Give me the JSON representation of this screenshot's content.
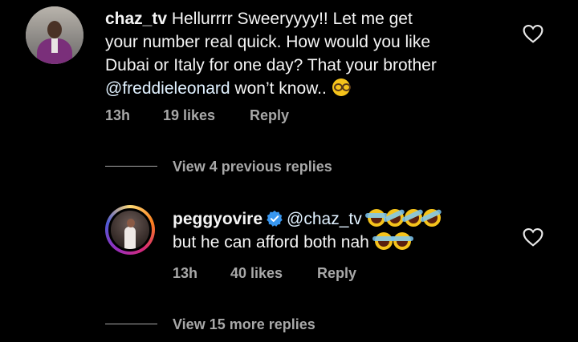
{
  "comments": [
    {
      "username": "chaz_tv",
      "text_line1": " Hellurrrr Sweeryyyy!! Let me get",
      "text_line2": "your number real quick. How would you like",
      "text_line3": "Dubai or Italy for one day? That your brother",
      "mention": "@freddieleonard",
      "text_line4_rest": " won’t know..",
      "emoji": "nerd-face",
      "time": "13h",
      "likes": "19 likes",
      "reply_label": "Reply"
    },
    {
      "username": "peggyovire",
      "verified": true,
      "mention": "@chaz_tv",
      "emojis_line1": [
        "laughing",
        "rolling-on-floor-laughing",
        "rolling-on-floor-laughing",
        "rolling-on-floor-laughing"
      ],
      "text_line2": "but he can afford both nah",
      "emojis_line2": [
        "laughing",
        "laughing"
      ],
      "time": "13h",
      "likes": "40 likes",
      "reply_label": "Reply"
    }
  ],
  "view_previous": "View 4 previous replies",
  "view_more": "View 15 more replies",
  "colors": {
    "background": "#000000",
    "text": "#f5f5f5",
    "secondary": "#a8a8a8",
    "mention": "#e0f1ff",
    "verified": "#3897f0"
  }
}
